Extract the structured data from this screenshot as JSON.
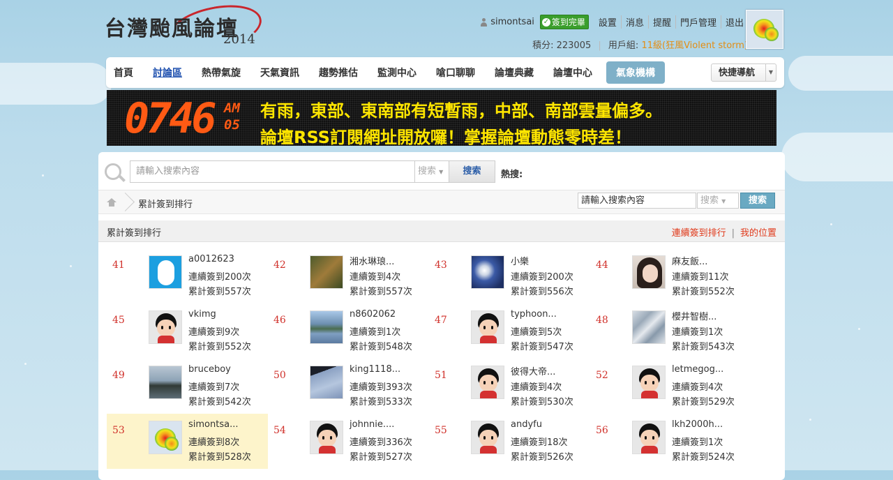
{
  "header": {
    "logo_text": "台灣颱風論壇",
    "logo_year": "2014",
    "username": "simontsai",
    "signed_badge": "簽到完畢",
    "links": [
      "設置",
      "消息",
      "提醒",
      "門戶管理",
      "退出"
    ],
    "points_label": "積分:",
    "points_value": "223005",
    "group_label": "用戶組:",
    "group_value": "11級(狂風Violent storm)"
  },
  "nav": {
    "items": [
      "首頁",
      "討論區",
      "熱帶氣旋",
      "天氣資訊",
      "趨勢推估",
      "監測中心",
      "嗆口聊聊",
      "論壇典藏",
      "論壇中心"
    ],
    "special": "氣象機構",
    "quick_nav": "快捷導航"
  },
  "banner": {
    "clock": "0746",
    "am": "AM",
    "sec": "05",
    "line1": "有雨，東部、東南部有短暫雨，中部、南部雲量偏多。",
    "line2": "論壇RSS訂閱網址開放囉！掌握論壇動態零時差！"
  },
  "search": {
    "placeholder": "請輸入搜索內容",
    "type": "搜索",
    "button": "搜索",
    "hot_label": "熱搜:"
  },
  "breadcrumb": {
    "label": "累計簽到排行",
    "search_value": "請輸入搜索內容",
    "search_type": "搜索",
    "search_button": "搜索"
  },
  "list": {
    "title": "累計簽到排行",
    "link1": "連續簽到排行",
    "link2": "我的位置",
    "cells": [
      {
        "rank": "41",
        "name": "a0012623",
        "s1": "連續簽到200次",
        "s2": "累計簽到557次",
        "avatar": "blue"
      },
      {
        "rank": "42",
        "name": "湘水琳琅...",
        "s1": "連續簽到4次",
        "s2": "累計簽到557次",
        "avatar": "leaf"
      },
      {
        "rank": "43",
        "name": "小樂",
        "s1": "連續簽到200次",
        "s2": "累計簽到556次",
        "avatar": "sat"
      },
      {
        "rank": "44",
        "name": "麻友飯...",
        "s1": "連續簽到11次",
        "s2": "累計簽到552次",
        "avatar": "girl"
      },
      {
        "rank": "45",
        "name": "vkimg",
        "s1": "連續簽到9次",
        "s2": "累計簽到552次",
        "avatar": "cartoon"
      },
      {
        "rank": "46",
        "name": "n8602062",
        "s1": "連續簽到1次",
        "s2": "累計簽到548次",
        "avatar": "lake"
      },
      {
        "rank": "47",
        "name": "typhoon...",
        "s1": "連續簽到5次",
        "s2": "累計簽到547次",
        "avatar": "cartoon"
      },
      {
        "rank": "48",
        "name": "櫻井智樹...",
        "s1": "連續簽到1次",
        "s2": "累計簽到543次",
        "avatar": "map"
      },
      {
        "rank": "49",
        "name": "bruceboy",
        "s1": "連續簽到7次",
        "s2": "累計簽到542次",
        "avatar": "coast"
      },
      {
        "rank": "50",
        "name": "king1118...",
        "s1": "連續簽到393次",
        "s2": "累計簽到533次",
        "avatar": "water"
      },
      {
        "rank": "51",
        "name": "彼得大帝...",
        "s1": "連續簽到4次",
        "s2": "累計簽到530次",
        "avatar": "cartoon"
      },
      {
        "rank": "52",
        "name": "letmegog...",
        "s1": "連續簽到4次",
        "s2": "累計簽到529次",
        "avatar": "cartoon"
      },
      {
        "rank": "53",
        "name": "simontsa...",
        "s1": "連續簽到8次",
        "s2": "累計簽到528次",
        "avatar": "radar",
        "me": true
      },
      {
        "rank": "54",
        "name": "johnnie....",
        "s1": "連續簽到336次",
        "s2": "累計簽到527次",
        "avatar": "cartoon"
      },
      {
        "rank": "55",
        "name": "andyfu",
        "s1": "連續簽到18次",
        "s2": "累計簽到526次",
        "avatar": "cartoon"
      },
      {
        "rank": "56",
        "name": "lkh2000h...",
        "s1": "連續簽到1次",
        "s2": "累計簽到524次",
        "avatar": "cartoon"
      }
    ]
  }
}
